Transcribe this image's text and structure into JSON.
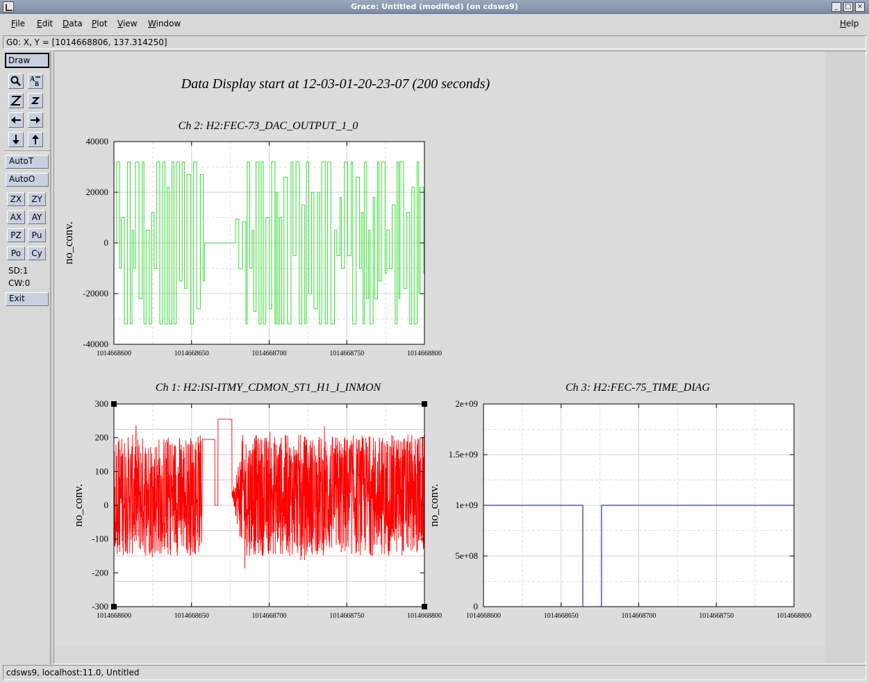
{
  "window": {
    "title": "Grace: Untitled (modified) (on cdsws9)",
    "minimize": "_",
    "maximize": "□",
    "close": "×"
  },
  "menubar": {
    "items": [
      {
        "label": "File",
        "key": "F",
        "rest": "ile"
      },
      {
        "label": "Edit",
        "key": "E",
        "rest": "dit"
      },
      {
        "label": "Data",
        "key": "D",
        "rest": "ata"
      },
      {
        "label": "Plot",
        "key": "P",
        "rest": "lot"
      },
      {
        "label": "View",
        "key": "V",
        "rest": "iew"
      },
      {
        "label": "Window",
        "key": "W",
        "rest": "indow"
      }
    ],
    "help": {
      "label": "Help",
      "key": "H",
      "rest": "elp"
    }
  },
  "locator": "G0: X, Y = [1014668806, 137.314250]",
  "toolbar": {
    "draw": "Draw",
    "zoom_icon": "magnifier-icon",
    "autot": "AutoT",
    "autoo": "AutoO",
    "zx": "ZX",
    "zy": "ZY",
    "ax": "AX",
    "ay": "AY",
    "pz": "PZ",
    "pu": "Pu",
    "po": "Po",
    "cy": "Cy",
    "sd": "SD:1",
    "cw": "CW:0",
    "exit": "Exit"
  },
  "main_title": "Data Display start at 12-03-01-20-23-07 (200 seconds)",
  "status": "cdsws9, localhost:11.0, Untitled",
  "colors": {
    "ch2": "#33dd33",
    "ch1": "#ff0000",
    "ch3": "#00008b"
  },
  "chart_data": [
    {
      "type": "line",
      "title": "Ch 2: H2:FEC-73_DAC_OUTPUT_1_0",
      "ylabel": "no_conv.",
      "xlim": [
        1014668600,
        1014668800
      ],
      "ylim": [
        -40000,
        40000
      ],
      "xticks": [
        "1014668600",
        "1014668650",
        "1014668700",
        "1014668750",
        "1014668800"
      ],
      "yticks": [
        "40000",
        "20000",
        "0",
        "-20000",
        "-40000"
      ],
      "series": [
        {
          "color": "#33dd33",
          "description": "step signal oscillating between about -32000 and 32000; flat at 0 from 1014668658 to 1014668677"
        }
      ]
    },
    {
      "type": "line",
      "title": "Ch 1: H2:ISI-ITMY_CDMON_ST1_H1_I_INMON",
      "ylabel": "no_conv.",
      "xlim": [
        1014668600,
        1014668800
      ],
      "ylim": [
        -300,
        300
      ],
      "xticks": [
        "1014668600",
        "1014668650",
        "1014668700",
        "1014668750",
        "1014668800"
      ],
      "yticks": [
        "300",
        "200",
        "100",
        "0",
        "-100",
        "-200",
        "-300"
      ],
      "series": [
        {
          "color": "#ff0000",
          "description": "dense noise roughly -200 to 260; plateau about 195 at 1014668657-1014668665, 0 at 1014668665-1014668667, about 255 at 1014668667-1014668676"
        }
      ]
    },
    {
      "type": "line",
      "title": "Ch 3: H2:FEC-75_TIME_DIAG",
      "ylabel": "no_conv.",
      "xlim": [
        1014668600,
        1014668800
      ],
      "ylim": [
        0,
        2000000000
      ],
      "xticks": [
        "1014668600",
        "1014668650",
        "1014668700",
        "1014668750",
        "1014668800"
      ],
      "yticks": [
        "2e+09",
        "1.5e+09",
        "1e+09",
        "5e+08",
        "0"
      ],
      "series": [
        {
          "color": "#00008b",
          "x": [
            1014668600,
            1014668664,
            1014668664,
            1014668676,
            1014668676,
            1014668800
          ],
          "y": [
            1000000000,
            1000000000,
            0,
            0,
            1000000000,
            1000000000
          ]
        }
      ]
    }
  ]
}
